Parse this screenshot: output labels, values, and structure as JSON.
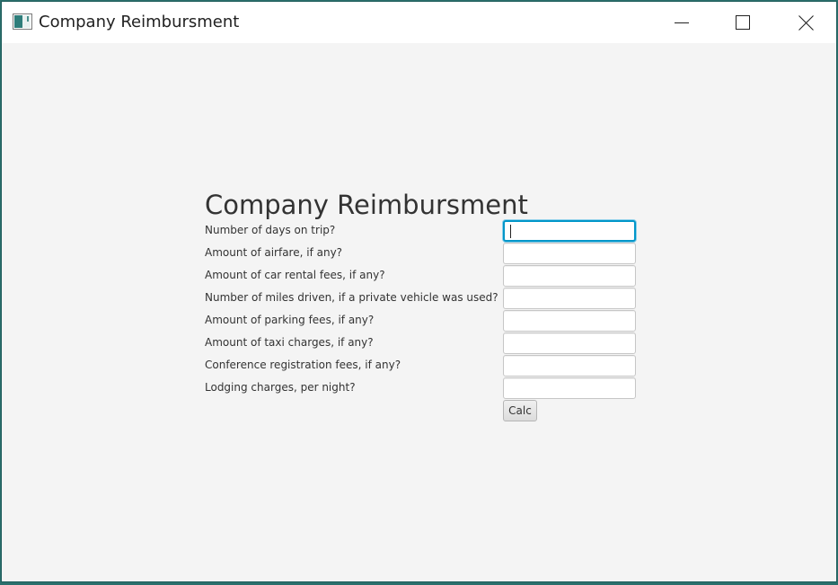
{
  "window": {
    "title": "Company Reimbursment",
    "minimize_icon": "minimize-icon",
    "maximize_icon": "maximize-icon",
    "close_icon": "close-icon"
  },
  "form": {
    "title": "Company Reimbursment",
    "fields": [
      {
        "label": "Number of days on trip?",
        "value": "",
        "focused": true
      },
      {
        "label": "Amount of airfare, if any?",
        "value": ""
      },
      {
        "label": "Amount of car rental fees, if any?",
        "value": ""
      },
      {
        "label": "Number of miles driven, if a private vehicle was used?",
        "value": ""
      },
      {
        "label": "Amount of parking fees, if any?",
        "value": ""
      },
      {
        "label": "Amount of taxi charges, if any?",
        "value": ""
      },
      {
        "label": "Conference registration fees, if any?",
        "value": ""
      },
      {
        "label": "Lodging charges, per night?",
        "value": ""
      }
    ],
    "calc_label": "Calc"
  },
  "colors": {
    "focus_accent": "#0096c9",
    "window_bg": "#f4f4f4",
    "titlebar_bg": "#ffffff",
    "desktop_bg": "#2b6f6c"
  }
}
